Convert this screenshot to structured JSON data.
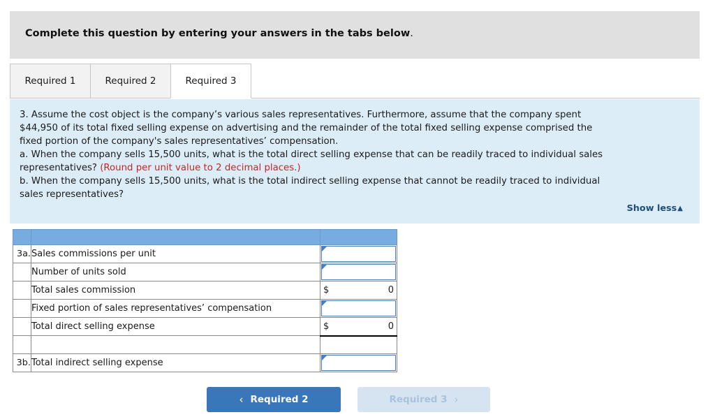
{
  "header": {
    "instruction_main": "Complete this question by entering your answers in the tabs below",
    "instruction_trailing": "."
  },
  "tabs": [
    {
      "label": "Required 1",
      "active": false
    },
    {
      "label": "Required 2",
      "active": false
    },
    {
      "label": "Required 3",
      "active": true
    }
  ],
  "question": {
    "line1": "3. Assume the cost object is the company’s various sales representatives. Furthermore, assume that the company spent",
    "line2": "$44,950 of its total fixed selling expense on advertising and the remainder of the total fixed selling expense comprised the",
    "line3": "fixed portion of the company's sales representatives’ compensation.",
    "line4a": "a. When the company sells 15,500 units, what is the total direct selling expense that can be readily traced to individual sales",
    "line4b": "representatives? ",
    "line4_note": "(Round per unit value to 2 decimal places.)",
    "line5": "b. When the company sells 15,500 units, what is the total indirect selling expense that cannot be readily traced to individual",
    "line6": "sales representatives?",
    "show_less_label": "Show less",
    "show_less_caret": "▲"
  },
  "table": {
    "rows": [
      {
        "index": "3a.",
        "label": "Sales commissions per unit",
        "value_type": "input",
        "value": "",
        "currency": "",
        "amount": "",
        "rule": false
      },
      {
        "index": "",
        "label": "Number of units sold",
        "value_type": "input",
        "value": "",
        "currency": "",
        "amount": "",
        "rule": false
      },
      {
        "index": "",
        "label": "Total sales commission",
        "value_type": "money",
        "value": "",
        "currency": "$",
        "amount": "0",
        "rule": false
      },
      {
        "index": "",
        "label": "Fixed portion of sales representatives’ compensation",
        "value_type": "input",
        "value": "",
        "currency": "",
        "amount": "",
        "rule": false
      },
      {
        "index": "",
        "label": "Total direct selling expense",
        "value_type": "money",
        "value": "",
        "currency": "$",
        "amount": "0",
        "rule": true
      },
      {
        "index": "",
        "label": "",
        "value_type": "empty",
        "value": "",
        "currency": "",
        "amount": "",
        "rule": false
      },
      {
        "index": "3b.",
        "label": "Total indirect selling expense",
        "value_type": "input",
        "value": "",
        "currency": "",
        "amount": "",
        "rule": false
      }
    ]
  },
  "nav": {
    "prev_label": "Required 2",
    "prev_chevron": "‹",
    "next_label": "Required 3",
    "next_chevron": "›"
  },
  "colors": {
    "header_bar": "#e0e0e0",
    "panel_blue": "#ddedf8",
    "table_header_blue": "#76ace0",
    "input_border_blue": "#4a7ebb",
    "link_navy": "#1f4e79",
    "note_red": "#cc2222",
    "button_active": "#3a76ba",
    "button_disabled": "#d6e3f0"
  }
}
